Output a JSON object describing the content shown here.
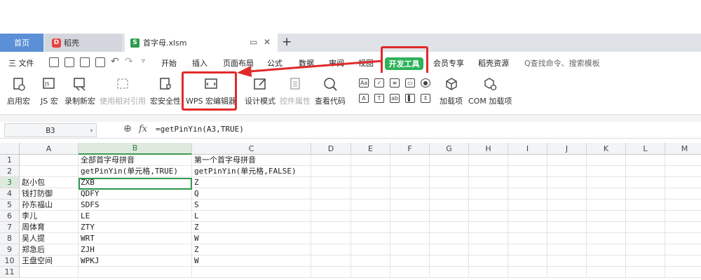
{
  "tabs": {
    "home": "首页",
    "docer": "稻壳",
    "file": "首字母.xlsm",
    "add": "+"
  },
  "menu": {
    "file": "三 文件",
    "items": [
      "开始",
      "插入",
      "页面布局",
      "公式",
      "数据",
      "审阅",
      "视图",
      "开发工具",
      "会员专享",
      "稻壳资源"
    ],
    "search": "Q查找命令、搜索模板"
  },
  "ribbon": {
    "enable_macro": "启用宏",
    "js_macro": "JS 宏",
    "record_macro": "录制新宏",
    "relative_ref": "使用相对引用",
    "macro_security": "宏安全性",
    "wps_editor": "WPS 宏编辑器",
    "design_mode": "设计模式",
    "control_props": "控件属性",
    "view_code": "查看代码",
    "addins": "加载项",
    "com_addins": "COM 加载项"
  },
  "formula_bar": {
    "name_box": "B3",
    "fx": "fx",
    "formula": "=getPinYin(A3,TRUE)"
  },
  "grid": {
    "columns": [
      "A",
      "B",
      "C",
      "D",
      "E",
      "F",
      "G",
      "H",
      "I",
      "J",
      "K",
      "L",
      "M"
    ],
    "rows": [
      [
        "1",
        "",
        "全部首字母拼音",
        "第一个首字母拼音"
      ],
      [
        "2",
        "",
        "getPinYin(单元格,TRUE)",
        "getPinYin(单元格,FALSE)"
      ],
      [
        "3",
        "赵小包",
        "ZXB",
        "Z"
      ],
      [
        "4",
        "钱打防御",
        "QDFY",
        "Q"
      ],
      [
        "5",
        "孙东福山",
        "SDFS",
        "S"
      ],
      [
        "6",
        "李儿",
        "LE",
        "L"
      ],
      [
        "7",
        "周体育",
        "ZTY",
        "Z"
      ],
      [
        "8",
        "吴人提",
        "WRT",
        "W"
      ],
      [
        "9",
        "郑急后",
        "ZJH",
        "Z"
      ],
      [
        "10",
        "王盘空间",
        "WPKJ",
        "W"
      ],
      [
        "11",
        "",
        "",
        ""
      ]
    ]
  },
  "colors": {
    "accent_green": "#2db35a",
    "highlight_red": "#e02a2a"
  }
}
